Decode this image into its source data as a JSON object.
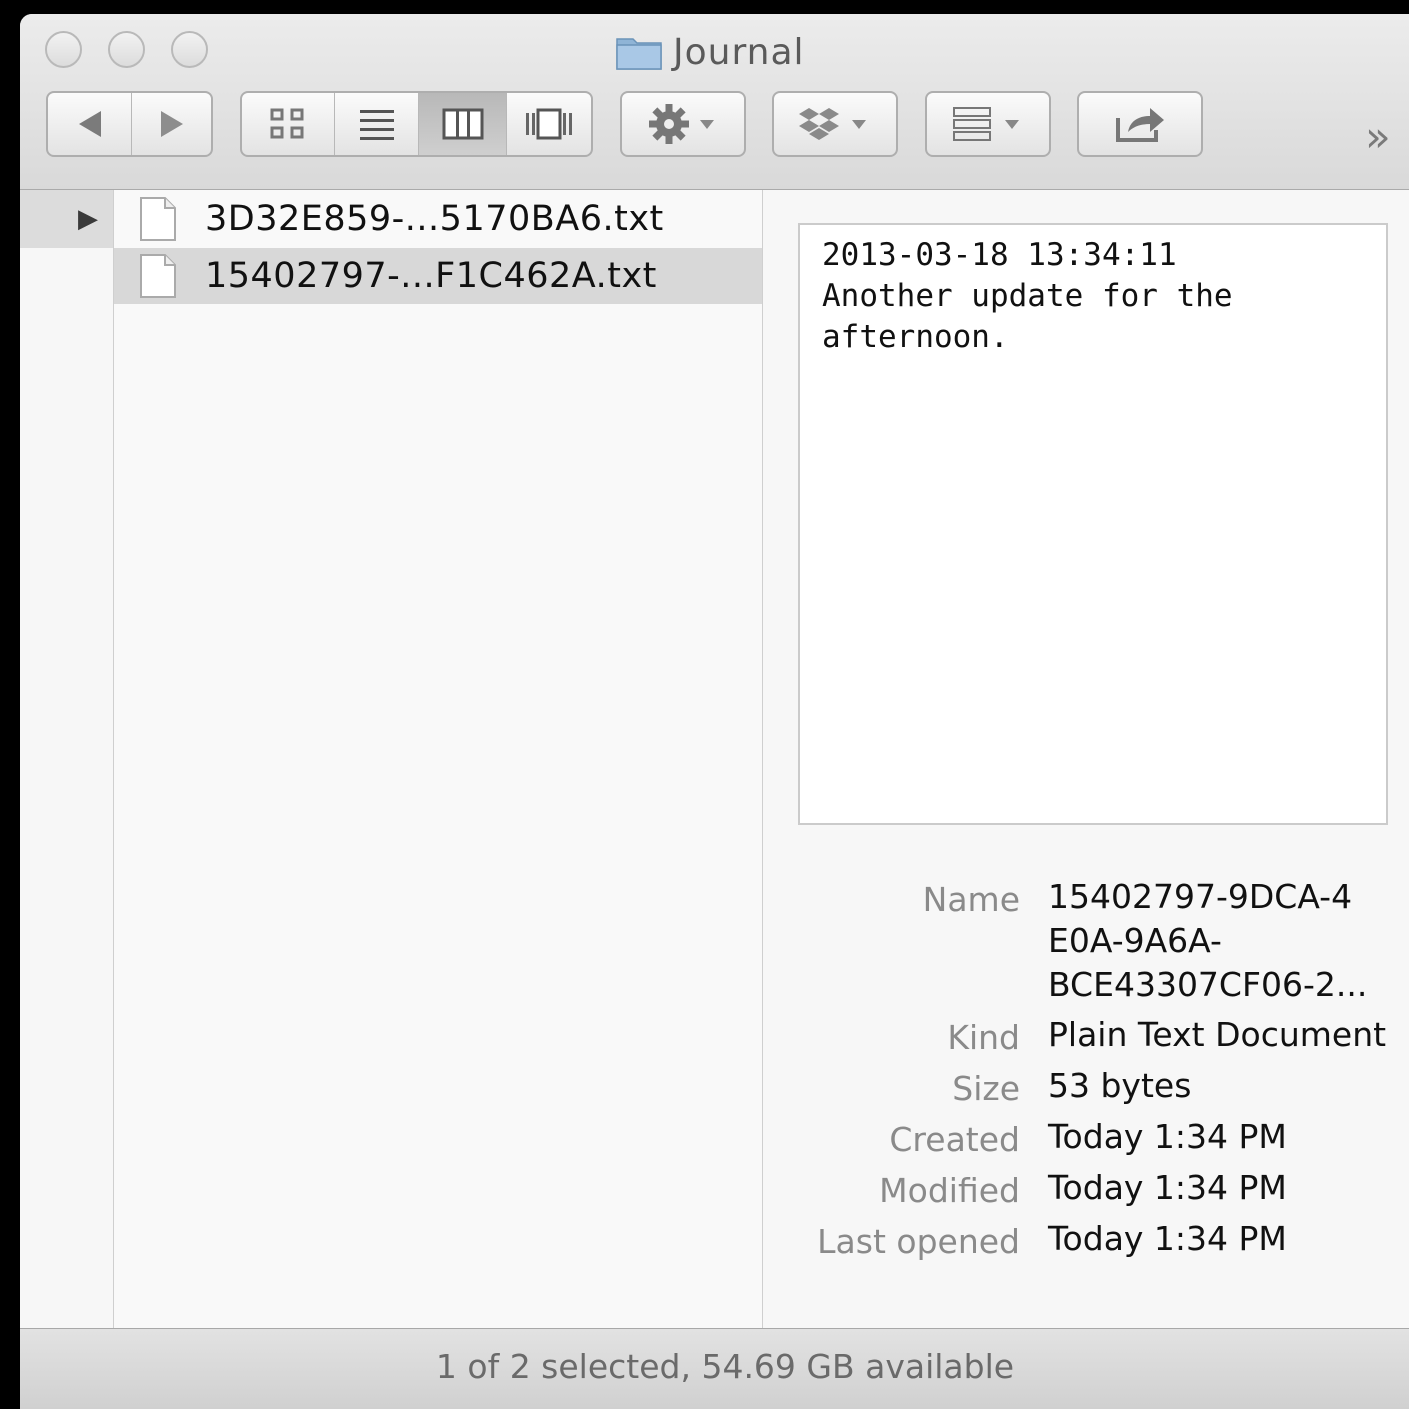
{
  "window": {
    "title": "Journal",
    "more_glyph": "»"
  },
  "toolbar": {
    "nav": [
      "back-icon",
      "forward-icon"
    ],
    "view_modes": [
      {
        "icon": "icon-view-icon",
        "active": false
      },
      {
        "icon": "list-view-icon",
        "active": false
      },
      {
        "icon": "column-view-icon",
        "active": true
      },
      {
        "icon": "coverflow-view-icon",
        "active": false
      }
    ],
    "buttons": [
      "gear-icon",
      "dropbox-icon",
      "arrange-icon",
      "share-icon"
    ]
  },
  "sidebar": {
    "disclosure_glyph": "▶"
  },
  "files": [
    {
      "name": "3D32E859-...5170BA6.txt",
      "selected": false
    },
    {
      "name": "15402797-...F1C462A.txt",
      "selected": true
    }
  ],
  "preview": {
    "lines": [
      "2013-03-18 13:34:11",
      "Another update for the",
      "afternoon."
    ]
  },
  "info": {
    "name_label": "Name",
    "name_value_lines": [
      "15402797-9DCA-4",
      "E0A-9A6A-",
      "BCE43307CF06-2..."
    ],
    "kind_label": "Kind",
    "kind_value": "Plain Text Document",
    "size_label": "Size",
    "size_value": "53 bytes",
    "created_label": "Created",
    "created_value": "Today 1:34 PM",
    "modified_label": "Modified",
    "modified_value": "Today 1:34 PM",
    "last_opened_label": "Last opened",
    "last_opened_value": "Today 1:34 PM"
  },
  "status": {
    "text": "1 of 2 selected, 54.69 GB available"
  }
}
